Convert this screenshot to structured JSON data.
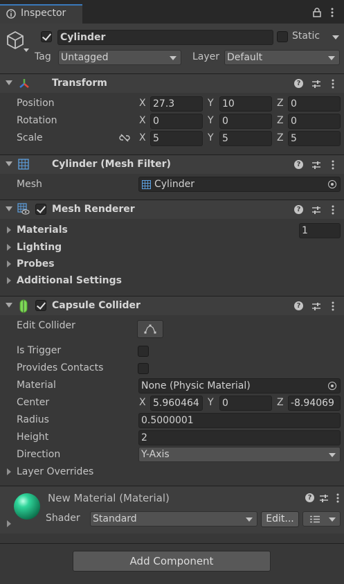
{
  "window": {
    "tab_label": "Inspector"
  },
  "gameobject": {
    "active": true,
    "name": "Cylinder",
    "static_label": "Static",
    "static": false,
    "tag_label": "Tag",
    "tag_value": "Untagged",
    "layer_label": "Layer",
    "layer_value": "Default"
  },
  "transform": {
    "title": "Transform",
    "rows": [
      {
        "label": "Position",
        "x": "27.3",
        "y": "10",
        "z": "0"
      },
      {
        "label": "Rotation",
        "x": "0",
        "y": "0",
        "z": "0"
      },
      {
        "label": "Scale",
        "x": "5",
        "y": "5",
        "z": "5"
      }
    ],
    "axis_x": "X",
    "axis_y": "Y",
    "axis_z": "Z"
  },
  "mesh_filter": {
    "title": "Cylinder (Mesh Filter)",
    "mesh_label": "Mesh",
    "mesh_value": "Cylinder"
  },
  "mesh_renderer": {
    "title": "Mesh Renderer",
    "enabled": true,
    "materials_label": "Materials",
    "materials_count": "1",
    "lighting_label": "Lighting",
    "probes_label": "Probes",
    "additional_label": "Additional Settings"
  },
  "capsule_collider": {
    "title": "Capsule Collider",
    "enabled": true,
    "edit_collider_label": "Edit Collider",
    "is_trigger_label": "Is Trigger",
    "provides_contacts_label": "Provides Contacts",
    "material_label": "Material",
    "material_value": "None (Physic Material)",
    "center_label": "Center",
    "center": {
      "x": "5.960464",
      "y": "0",
      "z": "-8.94069"
    },
    "radius_label": "Radius",
    "radius_value": "0.5000001",
    "height_label": "Height",
    "height_value": "2",
    "direction_label": "Direction",
    "direction_value": "Y-Axis",
    "layer_overrides_label": "Layer Overrides"
  },
  "material": {
    "title": "New Material (Material)",
    "shader_label": "Shader",
    "shader_value": "Standard",
    "edit_label": "Edit...",
    "sphere_color": "#1fbf8a"
  },
  "footer": {
    "add_component_label": "Add Component"
  }
}
